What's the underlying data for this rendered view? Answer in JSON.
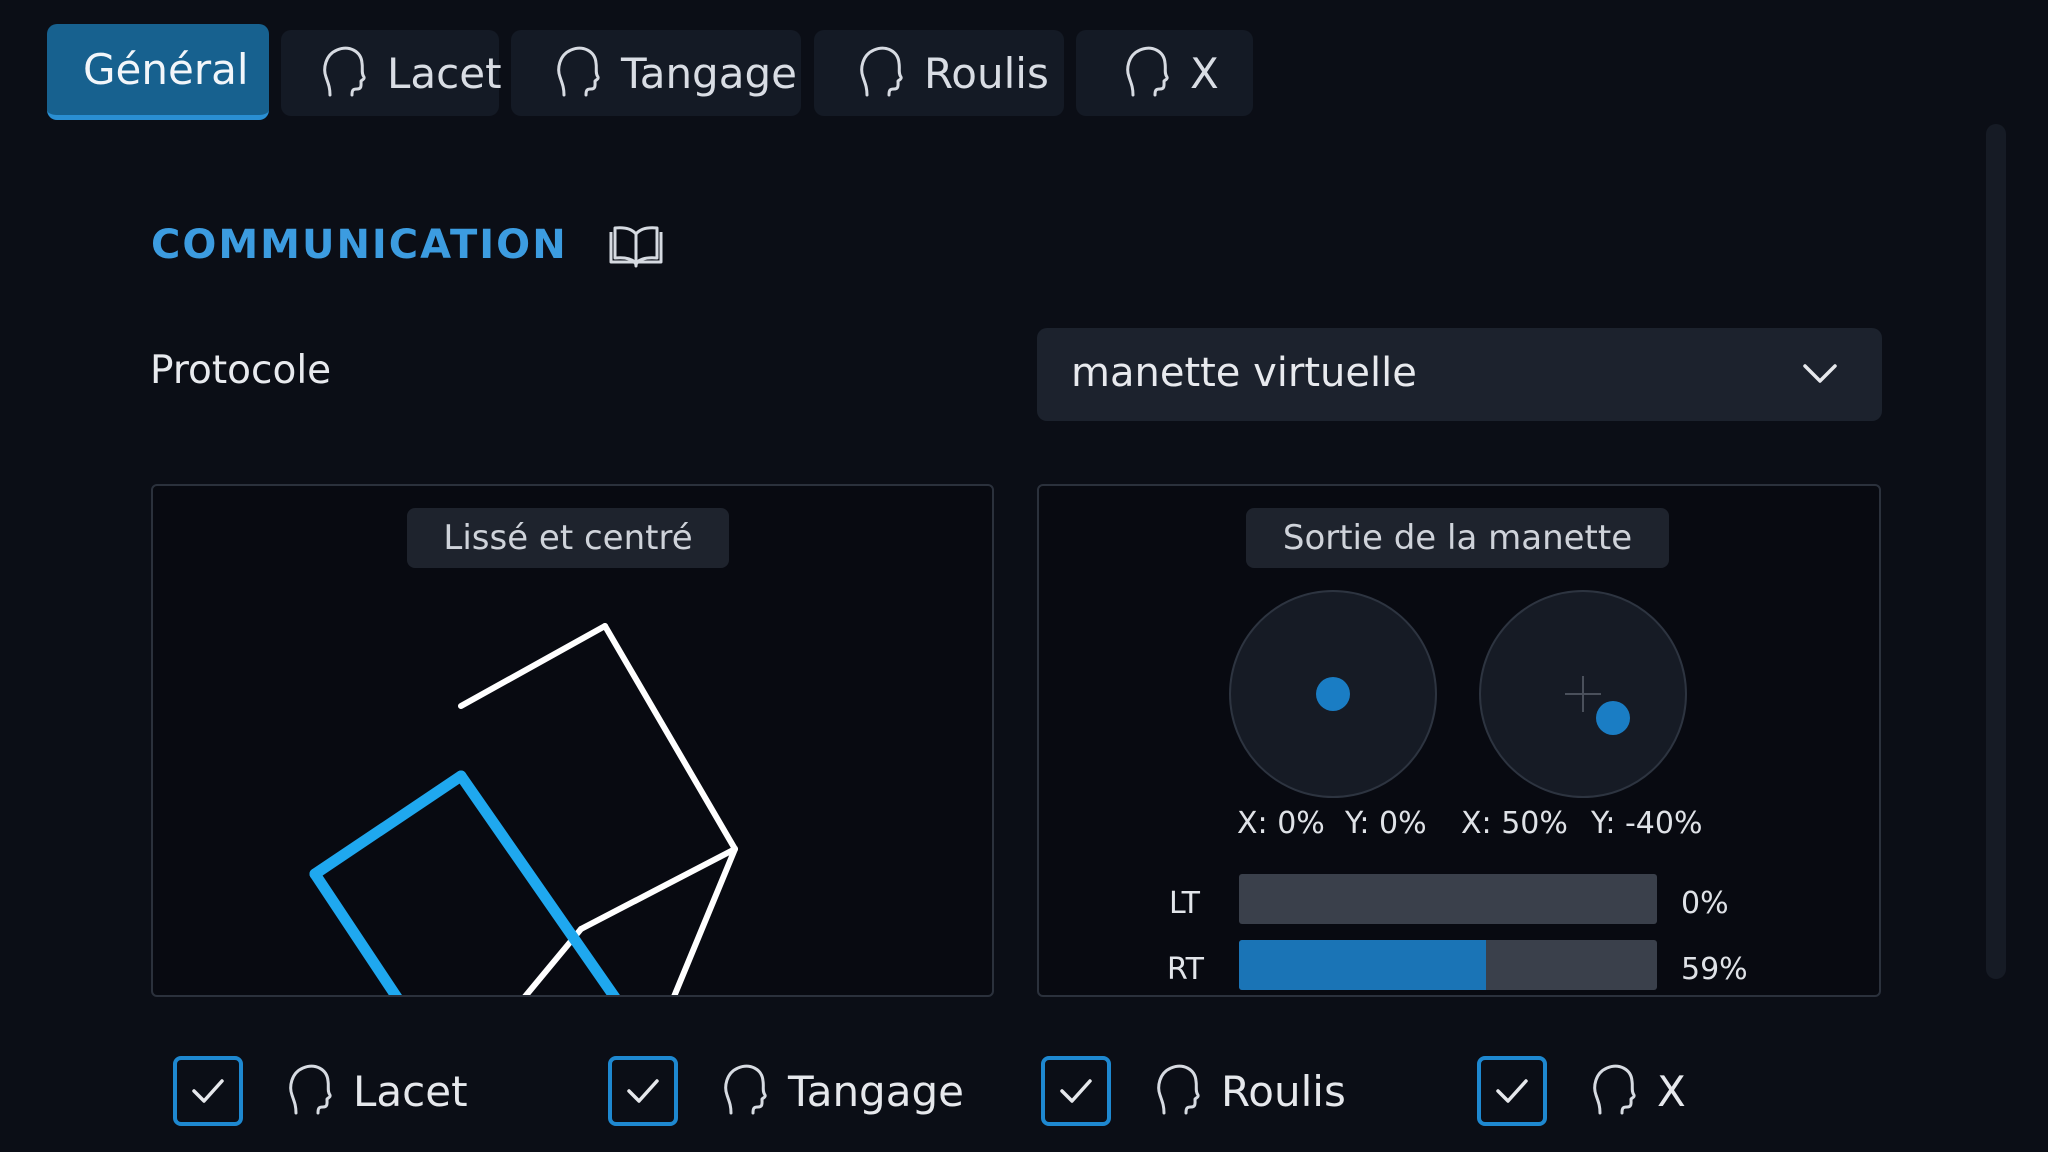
{
  "tabs": [
    {
      "label": "Général",
      "active": true
    },
    {
      "label": "Lacet",
      "icon": "head-profile-icon"
    },
    {
      "label": "Tangage",
      "icon": "head-profile-icon"
    },
    {
      "label": "Roulis",
      "icon": "head-profile-icon"
    },
    {
      "label": "X",
      "icon": "head-profile-icon"
    }
  ],
  "section": {
    "title": "COMMUNICATION",
    "icon": "book-icon"
  },
  "protocol": {
    "label": "Protocole",
    "value": "manette virtuelle"
  },
  "left_panel": {
    "label": "Lissé et centré"
  },
  "right_panel": {
    "label": "Sortie de la manette",
    "left_stick": {
      "x_text": "X: 0%",
      "y_text": "Y: 0%",
      "x": 0,
      "y": 0
    },
    "right_stick": {
      "x_text": "X: 50%",
      "y_text": "Y: -40%",
      "x": 50,
      "y": -40
    },
    "triggers": [
      {
        "name": "LT",
        "value_text": "0%",
        "value": 0
      },
      {
        "name": "RT",
        "value_text": "59%",
        "value": 59
      }
    ]
  },
  "checkboxes": [
    {
      "label": "Lacet",
      "checked": true
    },
    {
      "label": "Tangage",
      "checked": true
    },
    {
      "label": "Roulis",
      "checked": true
    },
    {
      "label": "X",
      "checked": true
    }
  ],
  "colors": {
    "accent": "#1a7dc4",
    "title": "#3c9ce0",
    "background": "#0b0e16",
    "cube_highlight": "#1fa8ef"
  }
}
